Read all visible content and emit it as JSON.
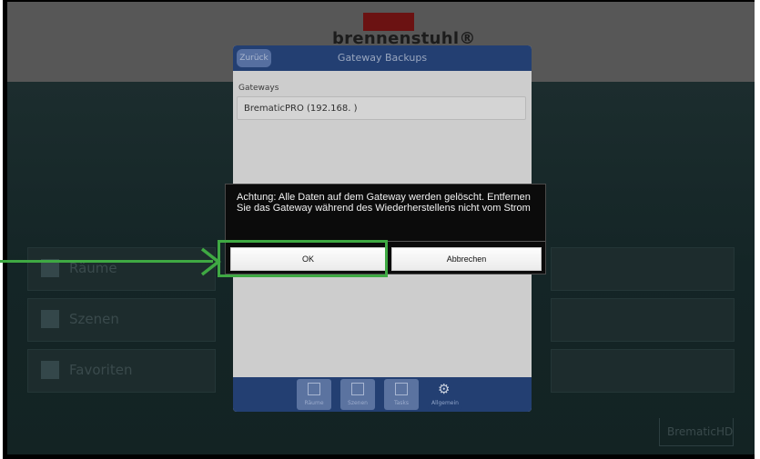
{
  "app": {
    "brand": "brennenstuhl®"
  },
  "background": {
    "tiles": [
      "Räume",
      "Szenen",
      "Favoriten"
    ],
    "logo_text": "BrematicHD"
  },
  "panel": {
    "back_label": "Zurück",
    "title": "Gateway Backups",
    "gateways_label": "Gateways",
    "gateway_value": "BrematicPRO (192.168.           )"
  },
  "bottom_nav": {
    "items": [
      {
        "label": "Räume",
        "icon": "rooms-icon"
      },
      {
        "label": "Szenen",
        "icon": "scenes-icon"
      },
      {
        "label": "Tasks",
        "icon": "tasks-icon"
      },
      {
        "label": "Allgemein",
        "icon": "gear-icon"
      }
    ],
    "active_index": 3
  },
  "dialog": {
    "message": "Achtung: Alle Daten auf dem Gateway werden gelöscht. Entfernen Sie das Gateway während des Wiederherstellens nicht vom Strom",
    "ok_label": "OK",
    "cancel_label": "Abbrechen"
  },
  "colors": {
    "header_blue": "#233f72",
    "highlight_green": "#3fa943"
  }
}
